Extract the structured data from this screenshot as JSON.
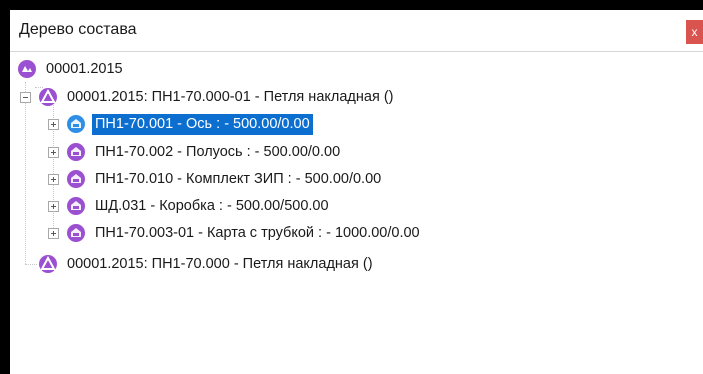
{
  "window": {
    "title": "Дерево состава",
    "close_label": "x"
  },
  "tree": {
    "root": {
      "label": "00001.2015",
      "icon": "assembly-icon"
    },
    "items": [
      {
        "label": "00001.2015: ПН1-70.000-01 - Петля накладная ()",
        "icon": "assembly-icon",
        "expander": "minus"
      },
      {
        "label": "ПН1-70.001 - Ось : - 500.00/0.00",
        "icon": "part-icon",
        "expander": "plus",
        "selected": true
      },
      {
        "label": "ПН1-70.002 - Полуось : - 500.00/0.00",
        "icon": "part-icon",
        "expander": "plus"
      },
      {
        "label": "ПН1-70.010 - Комплект ЗИП : - 500.00/0.00",
        "icon": "part-icon",
        "expander": "plus"
      },
      {
        "label": "ШД.031 - Коробка : - 500.00/500.00",
        "icon": "part-icon",
        "expander": "plus"
      },
      {
        "label": "ПН1-70.003-01 - Карта с трубкой : - 1000.00/0.00",
        "icon": "part-icon",
        "expander": "plus"
      },
      {
        "label": "00001.2015: ПН1-70.000 - Петля накладная ()",
        "icon": "assembly-icon"
      }
    ]
  },
  "colors": {
    "selection": "#0c6fd0",
    "icon_purple": "#9b4fd1",
    "icon_blue": "#2f8fe6",
    "close": "#d9534f"
  }
}
